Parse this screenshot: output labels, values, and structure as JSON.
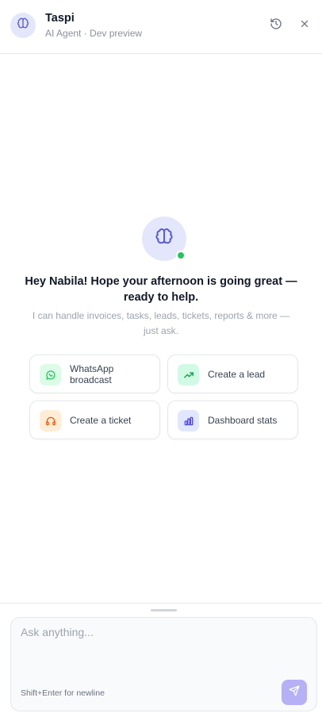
{
  "header": {
    "title": "Taspi",
    "subtitle": "AI Agent · Dev preview",
    "avatar_icon": "brain-icon",
    "history_icon": "history-icon",
    "close_icon": "close-icon"
  },
  "hero": {
    "icon": "brain-icon",
    "online": true,
    "greeting": "Hey Nabila! Hope your afternoon is going great — ready to help.",
    "tagline": "I can handle invoices, tasks, leads, tickets, reports & more — just ask."
  },
  "actions": [
    {
      "label": "WhatsApp broadcast",
      "icon": "whatsapp-icon",
      "color": "#22c55e",
      "bg": "#dcfce7"
    },
    {
      "label": "Create a lead",
      "icon": "trending-up-icon",
      "color": "#16a34a",
      "bg": "#d1fae5"
    },
    {
      "label": "Create a ticket",
      "icon": "headset-icon",
      "color": "#ea580c",
      "bg": "#ffedd5"
    },
    {
      "label": "Dashboard stats",
      "icon": "bar-chart-icon",
      "color": "#4f46e5",
      "bg": "#e0e7ff"
    }
  ],
  "composer": {
    "placeholder": "Ask anything...",
    "hint": "Shift+Enter for newline",
    "send_icon": "send-icon"
  },
  "colors": {
    "accent": "#6366f1",
    "accent_soft": "#e4e7fb",
    "send_button": "#b6b0f6",
    "online": "#22c55e"
  }
}
